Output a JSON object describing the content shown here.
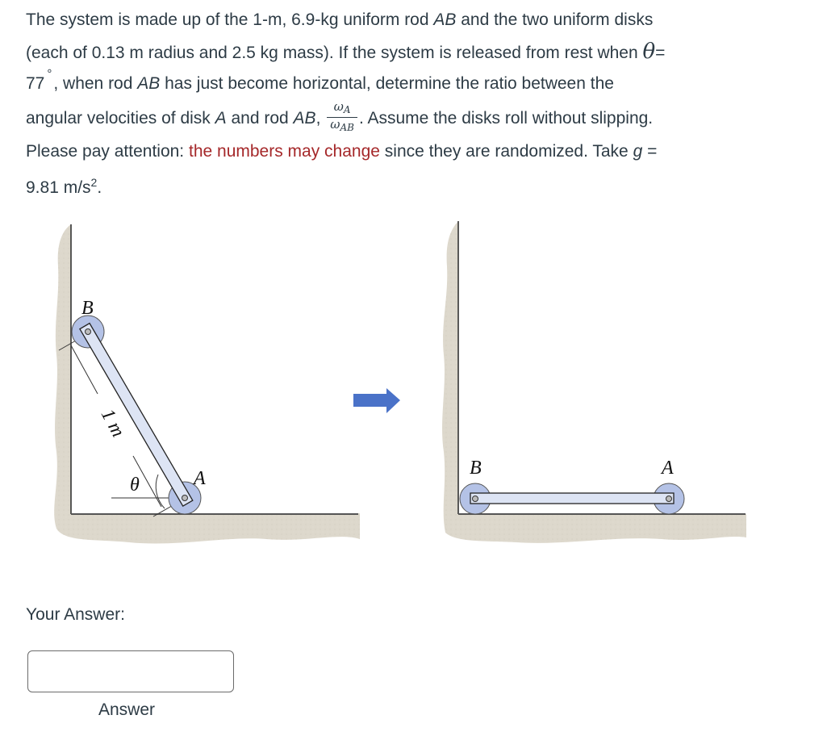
{
  "question": {
    "line1_a": "The system is made up of the 1-m, 6.9-kg uniform rod ",
    "rod_name": "AB",
    "line1_b": " and the two uniform disks",
    "line2": "(each of 0.13 m radius and 2.5 kg mass). If the system is released from rest when ",
    "theta_symbol": "θ",
    "equals": "=",
    "angle_value": "77",
    "degree_symbol": "°",
    "line3_a": ", when rod ",
    "line3_b": " has just become horizontal, determine the ratio between the",
    "line4_a": "angular velocities of disk ",
    "disk_name": "A",
    "line4_b": " and rod ",
    "line4_c": ",",
    "frac_num_symbol": "ω",
    "frac_num_sub": "A",
    "frac_den_symbol": "ω",
    "frac_den_sub": "AB",
    "line4_d": ". Assume the disks roll without slipping.",
    "line5_a": "Please pay attention: ",
    "warning": "the numbers may change",
    "line5_b": " since they are randomized. Take ",
    "g_symbol": "g",
    "line5_c": " =",
    "g_value": "9.81 m/s",
    "g_exp": "2",
    "g_end": ".",
    "colors": {
      "text": "#2d3b45",
      "warning": "#a5282a"
    }
  },
  "figure": {
    "left_diagram": {
      "label_B": "B",
      "label_A": "A",
      "length_label": "1 m",
      "angle_label": "θ"
    },
    "arrow": {
      "direction": "right",
      "color": "#4a72c8"
    },
    "right_diagram": {
      "label_B": "B",
      "label_A": "A"
    },
    "colors": {
      "ground": "#ddd8cc",
      "disk": "#b4c2e6",
      "rod": "#dde4f4",
      "outline": "#333333"
    }
  },
  "answer": {
    "label": "Your Answer:",
    "input_value": "",
    "input_placeholder": "",
    "caption": "Answer"
  }
}
